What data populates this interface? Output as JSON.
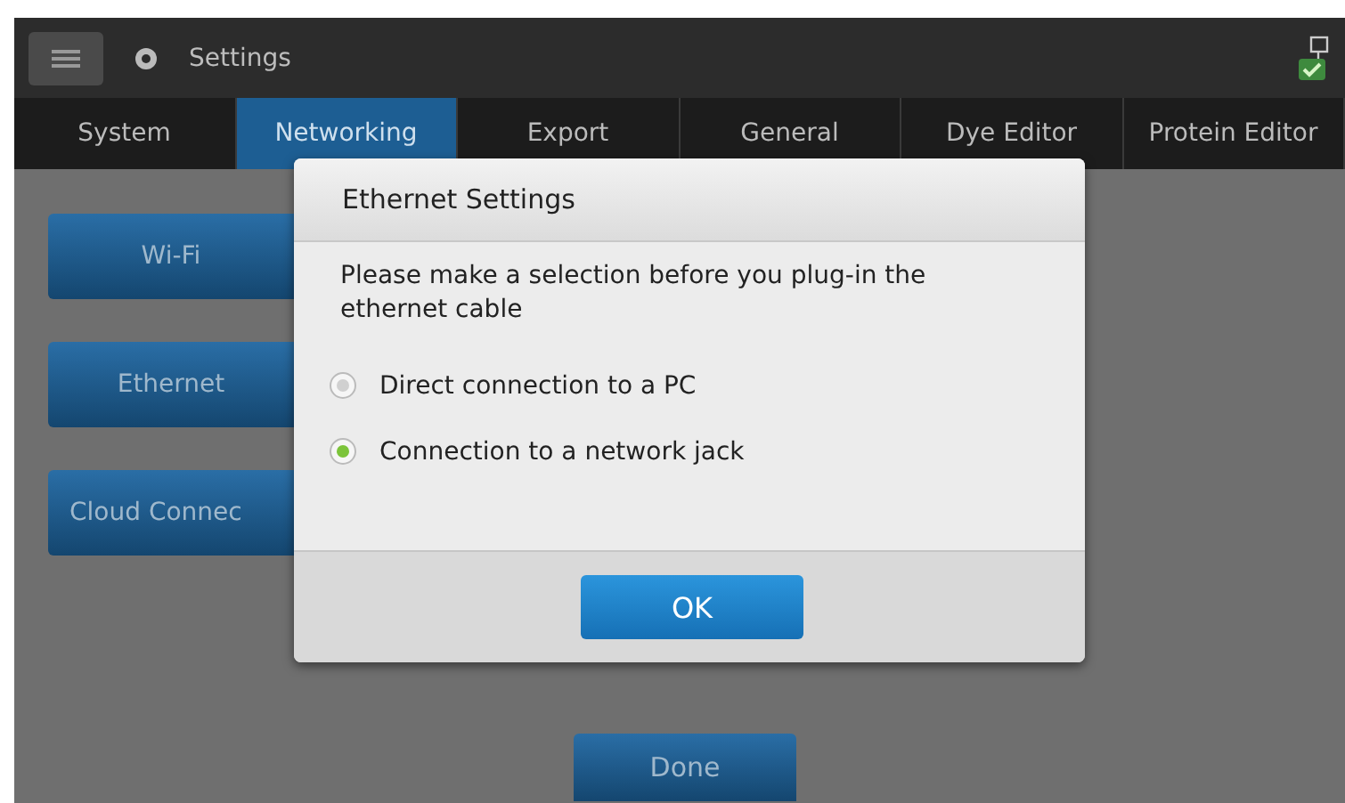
{
  "app_bar": {
    "title": "Settings"
  },
  "tabs": [
    {
      "label": "System",
      "selected": false
    },
    {
      "label": "Networking",
      "selected": true
    },
    {
      "label": "Export",
      "selected": false
    },
    {
      "label": "General",
      "selected": false
    },
    {
      "label": "Dye Editor",
      "selected": false
    },
    {
      "label": "Protein Editor",
      "selected": false
    }
  ],
  "side_buttons": [
    "Wi-Fi",
    "Ethernet",
    "Cloud Connec"
  ],
  "done_button": "Done",
  "dialog": {
    "title": "Ethernet Settings",
    "message": "Please make a selection before you plug-in the ethernet cable",
    "options": [
      {
        "label": "Direct connection to a PC",
        "selected": false
      },
      {
        "label": "Connection to a network jack",
        "selected": true
      }
    ],
    "ok_button": "OK"
  }
}
